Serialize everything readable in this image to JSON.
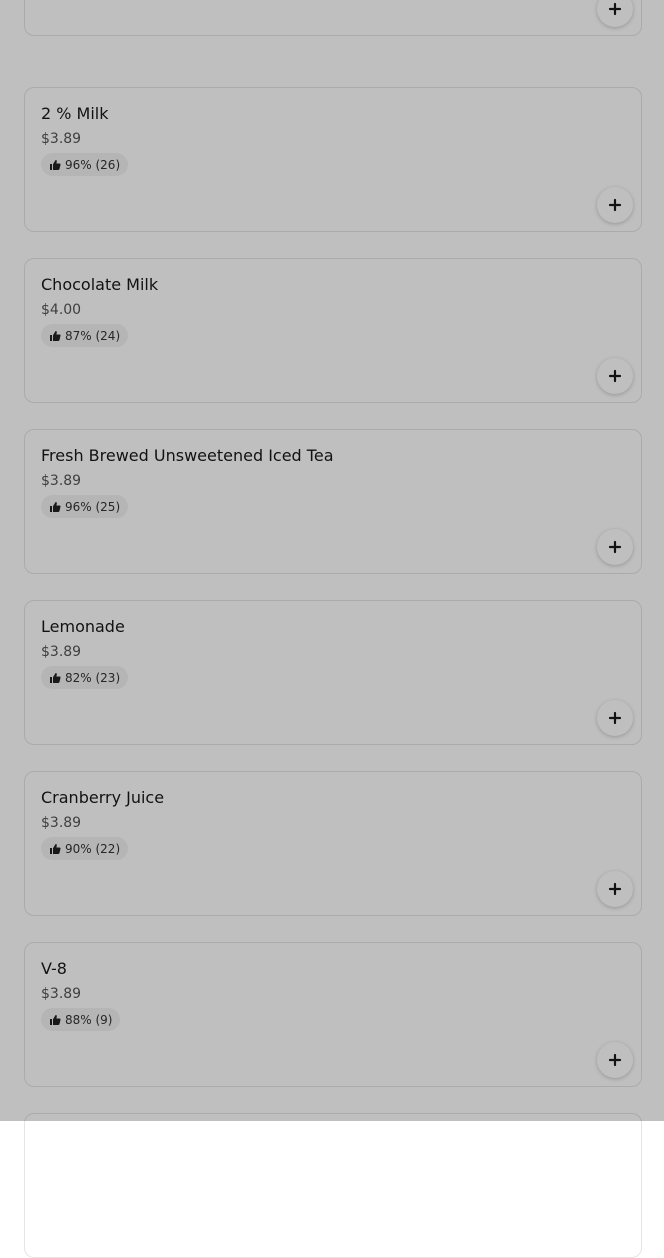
{
  "items": [
    {
      "name": "",
      "price": "",
      "rating": "",
      "icon": "thumbs-up-icon",
      "add_icon": "plus-icon"
    },
    {
      "name": "2 % Milk",
      "price": "$3.89",
      "rating": "96% (26)",
      "icon": "thumbs-up-icon",
      "add_icon": "plus-icon"
    },
    {
      "name": "Chocolate Milk",
      "price": "$4.00",
      "rating": "87% (24)",
      "icon": "thumbs-up-icon",
      "add_icon": "plus-icon"
    },
    {
      "name": "Fresh Brewed Unsweetened Iced Tea",
      "price": "$3.89",
      "rating": "96% (25)",
      "icon": "thumbs-up-icon",
      "add_icon": "plus-icon"
    },
    {
      "name": "Lemonade",
      "price": "$3.89",
      "rating": "82% (23)",
      "icon": "thumbs-up-icon",
      "add_icon": "plus-icon"
    },
    {
      "name": "Cranberry Juice",
      "price": "$3.89",
      "rating": "90% (22)",
      "icon": "thumbs-up-icon",
      "add_icon": "plus-icon"
    },
    {
      "name": "V-8",
      "price": "$3.89",
      "rating": "88% (9)",
      "icon": "thumbs-up-icon",
      "add_icon": "plus-icon"
    },
    {
      "name": "",
      "price": "",
      "rating": "",
      "icon": "thumbs-up-icon",
      "add_icon": "plus-icon"
    }
  ],
  "colors": {
    "card_border": "#e4e4e4",
    "rating_badge_bg": "#f2f2f2",
    "overlay": "rgba(0,0,0,0.25)"
  }
}
